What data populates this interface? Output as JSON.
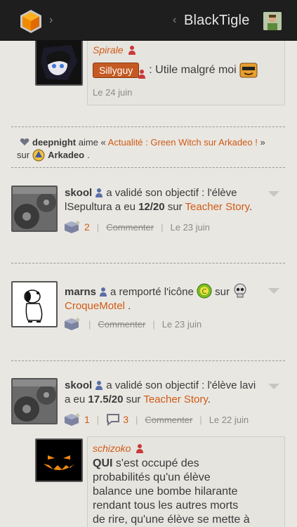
{
  "header": {
    "title": "BlackTigle",
    "back_chevron": "‹",
    "logo_chevron": "›"
  },
  "comment_top": {
    "author": "Spirale",
    "badge": "Sillyguy",
    "text": ": Utile malgré moi",
    "date": "Le 24 juin"
  },
  "like_item": {
    "user": "deepnight",
    "verb": "aime «",
    "link": "Actualité : Green Witch sur Arkadeo !",
    "close": "»",
    "on": "sur",
    "group": "Arkadeo",
    "period": "."
  },
  "feed": [
    {
      "user": "skool",
      "line1_rest": "a validé son objectif : l'élève",
      "line2_pre": "lSepultura a eu",
      "score": "12/20",
      "sur": "sur",
      "game": "Teacher Story",
      "period": ".",
      "likes": "2",
      "comment_label": "Commenter",
      "date": "Le 23 juin"
    },
    {
      "user": "marns",
      "line1_rest": "a remporté l'icône",
      "sur": "sur",
      "game": "CroqueMotel",
      "period": ".",
      "comment_label": "Commenter",
      "date": "Le 23 juin"
    },
    {
      "user": "skool",
      "line1_rest": "a validé son objectif : l'élève lavi",
      "line2_pre": "a eu",
      "score": "17.5/20",
      "sur": "sur",
      "game": "Teacher Story",
      "period": ".",
      "likes": "1",
      "comments": "3",
      "comment_label": "Commenter",
      "date": "Le 22 juin"
    }
  ],
  "comment_bottom": {
    "author": "schizoko",
    "bold": "QUI",
    "lines": [
      "s'est occupé des",
      "probabilités qu'un élève",
      "balance une bombe hilarante",
      "rendant tous les autres morts",
      "de rire, qu'une élève se mette à"
    ]
  },
  "colors": {
    "accent": "#d05a14",
    "header_bg": "#1e1e1e",
    "page_bg": "#e9e7e2"
  },
  "icons": [
    "orange-cube-logo-icon",
    "user-silhouette-icon",
    "heart-icon",
    "like-cube-icon",
    "speech-bubble-icon",
    "chevron-down-icon"
  ]
}
